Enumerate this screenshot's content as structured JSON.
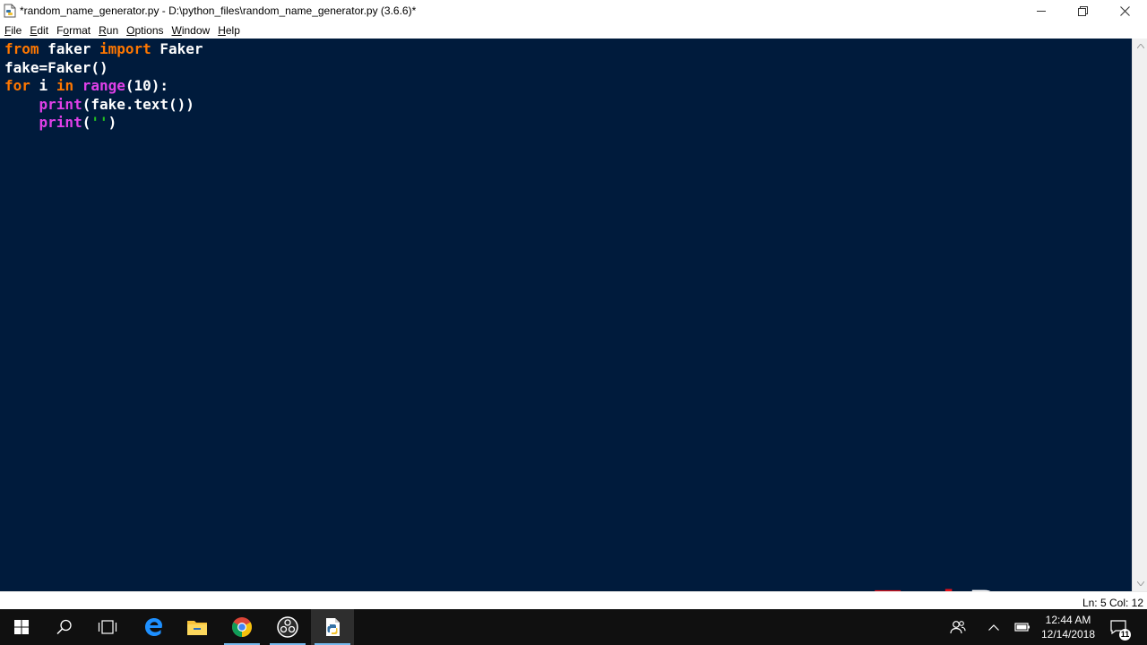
{
  "window": {
    "title": "*random_name_generator.py - D:\\python_files\\random_name_generator.py (3.6.6)*",
    "app_icon": "python-file-icon",
    "controls": [
      "minimize-icon",
      "restore-icon",
      "close-icon"
    ]
  },
  "menu": {
    "items": [
      {
        "pre": "",
        "accel": "F",
        "post": "ile"
      },
      {
        "pre": "",
        "accel": "E",
        "post": "dit"
      },
      {
        "pre": "F",
        "accel": "o",
        "post": "rmat"
      },
      {
        "pre": "",
        "accel": "R",
        "post": "un"
      },
      {
        "pre": "",
        "accel": "O",
        "post": "ptions"
      },
      {
        "pre": "",
        "accel": "W",
        "post": "indow"
      },
      {
        "pre": "",
        "accel": "H",
        "post": "elp"
      }
    ]
  },
  "editor": {
    "background": "#001b3c",
    "lines": [
      [
        {
          "t": "from",
          "k": "kw"
        },
        {
          "t": " faker ",
          "k": ""
        },
        {
          "t": "import",
          "k": "kw"
        },
        {
          "t": " Faker",
          "k": ""
        }
      ],
      [
        {
          "t": "fake=Faker()",
          "k": ""
        }
      ],
      [
        {
          "t": "for",
          "k": "kw"
        },
        {
          "t": " i ",
          "k": ""
        },
        {
          "t": "in",
          "k": "kw"
        },
        {
          "t": " ",
          "k": ""
        },
        {
          "t": "range",
          "k": "bi"
        },
        {
          "t": "(10):",
          "k": ""
        }
      ],
      [
        {
          "t": "    ",
          "k": ""
        },
        {
          "t": "print",
          "k": "bi"
        },
        {
          "t": "(fake.text())",
          "k": ""
        }
      ],
      [
        {
          "t": "    ",
          "k": ""
        },
        {
          "t": "print",
          "k": "bi"
        },
        {
          "t": "(",
          "k": ""
        },
        {
          "t": "''",
          "k": "str"
        },
        {
          "t": ")",
          "k": ""
        }
      ]
    ]
  },
  "watermark": {
    "part1": "Tech",
    "part2": "Preneur",
    "color1": "#e8101a",
    "color2": "#ffffff"
  },
  "status": {
    "text": "Ln: 5   Col: 12"
  },
  "taskbar": {
    "apps": [
      "windows-start-icon",
      "search-icon",
      "task-view-icon",
      "edge-icon",
      "file-explorer-icon",
      "chrome-icon",
      "obs-icon",
      "idle-python-icon"
    ],
    "tray": [
      "people-icon",
      "chevron-up-icon",
      "battery-icon",
      "action-center-icon"
    ],
    "clock": {
      "time": "12:44 AM",
      "date": "12/14/2018"
    },
    "notifications": "11"
  }
}
